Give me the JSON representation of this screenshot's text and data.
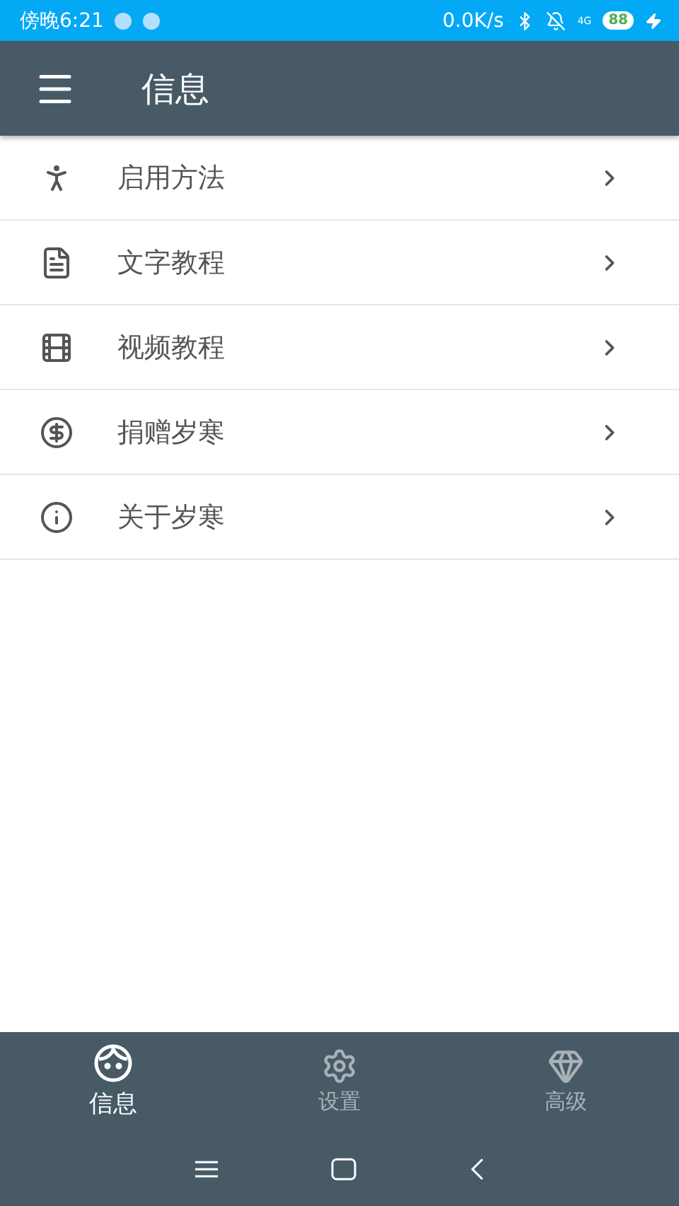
{
  "status_bar": {
    "time": "傍晚6:21",
    "net_speed": "0.0K/s",
    "network": "4G",
    "battery": "88"
  },
  "app_bar": {
    "title": "信息"
  },
  "menu_items": [
    {
      "label": "启用方法"
    },
    {
      "label": "文字教程"
    },
    {
      "label": "视频教程"
    },
    {
      "label": "捐赠岁寒"
    },
    {
      "label": "关于岁寒"
    }
  ],
  "bottom_nav": [
    {
      "label": "信息",
      "selected": true
    },
    {
      "label": "设置",
      "selected": false
    },
    {
      "label": "高级",
      "selected": false
    }
  ]
}
